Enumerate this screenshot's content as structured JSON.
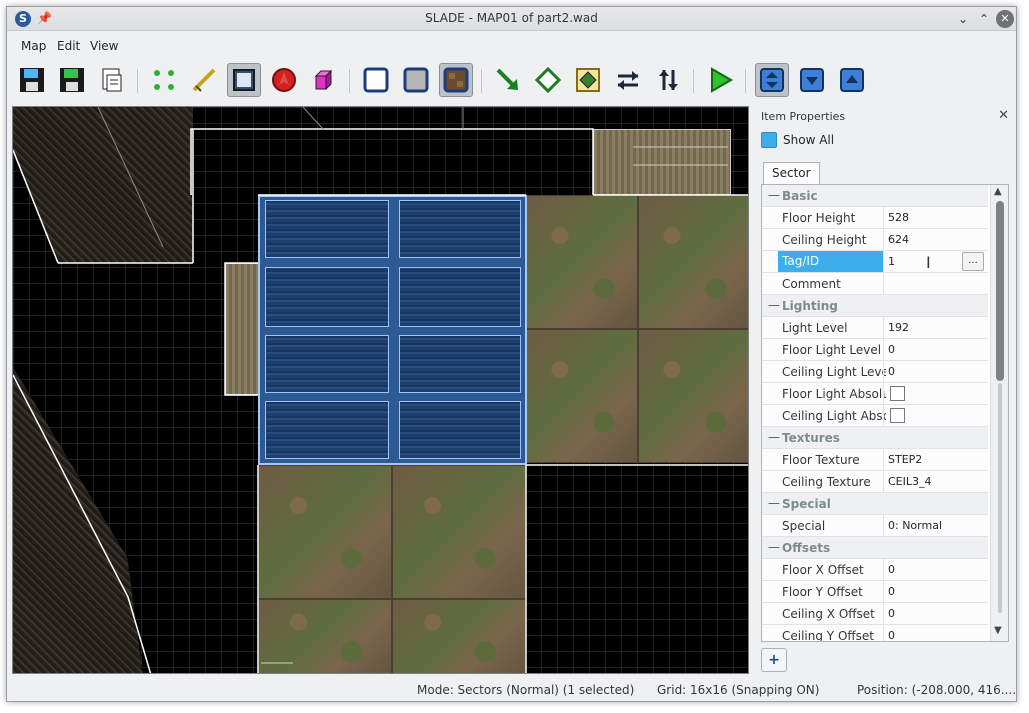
{
  "window": {
    "title": "SLADE - MAP01 of part2.wad"
  },
  "menu": {
    "items": [
      "Map",
      "Edit",
      "View"
    ]
  },
  "toolbar": {
    "icons": [
      "save-icon",
      "save-all-icon",
      "save-as-icon",
      "vertex-mode-icon",
      "line-mode-icon",
      "sector-mode-icon",
      "thing-mode-icon",
      "3d-mode-icon",
      "flat-none-icon",
      "flat-untextured-icon",
      "flat-textured-icon",
      "arrow-icon",
      "diamond-icon",
      "texture-browser-icon",
      "swap-horizontal-icon",
      "swap-vertical-icon",
      "play-icon",
      "toggle-panel-icon",
      "scroll-down-icon",
      "scroll-up-icon"
    ]
  },
  "panel": {
    "title": "Item Properties",
    "show_all": "Show All",
    "tab": "Sector",
    "rows": [
      {
        "type": "cat",
        "name": "Basic"
      },
      {
        "type": "prop",
        "name": "Floor Height",
        "value": "528"
      },
      {
        "type": "prop",
        "name": "Ceiling Height",
        "value": "624"
      },
      {
        "type": "selected",
        "name": "Tag/ID",
        "value": "1"
      },
      {
        "type": "prop",
        "name": "Comment",
        "value": ""
      },
      {
        "type": "cat",
        "name": "Lighting"
      },
      {
        "type": "prop",
        "name": "Light Level",
        "value": "192"
      },
      {
        "type": "prop",
        "name": "Floor Light Level",
        "value": "0"
      },
      {
        "type": "prop",
        "name": "Ceiling Light Level",
        "value": "0"
      },
      {
        "type": "check",
        "name": "Floor Light Absolute",
        "value": ""
      },
      {
        "type": "check",
        "name": "Ceiling Light Absolute",
        "value": ""
      },
      {
        "type": "cat",
        "name": "Textures"
      },
      {
        "type": "prop",
        "name": "Floor Texture",
        "value": "STEP2"
      },
      {
        "type": "prop",
        "name": "Ceiling Texture",
        "value": "CEIL3_4"
      },
      {
        "type": "cat",
        "name": "Special"
      },
      {
        "type": "prop",
        "name": "Special",
        "value": "0: Normal"
      },
      {
        "type": "cat",
        "name": "Offsets"
      },
      {
        "type": "prop",
        "name": "Floor X Offset",
        "value": "0"
      },
      {
        "type": "prop",
        "name": "Floor Y Offset",
        "value": "0"
      },
      {
        "type": "prop",
        "name": "Ceiling X Offset",
        "value": "0"
      },
      {
        "type": "prop",
        "name": "Ceiling Y Offset",
        "value": "0"
      }
    ],
    "dots_label": "...",
    "add_label": "+"
  },
  "status": {
    "mode": "Mode: Sectors (Normal) (1 selected)",
    "grid": "Grid: 16x16 (Snapping ON)",
    "position": "Position: (-208.000, 416...."
  },
  "colors": {
    "accent": "#3daee9",
    "selection": "#a9c7f5"
  }
}
